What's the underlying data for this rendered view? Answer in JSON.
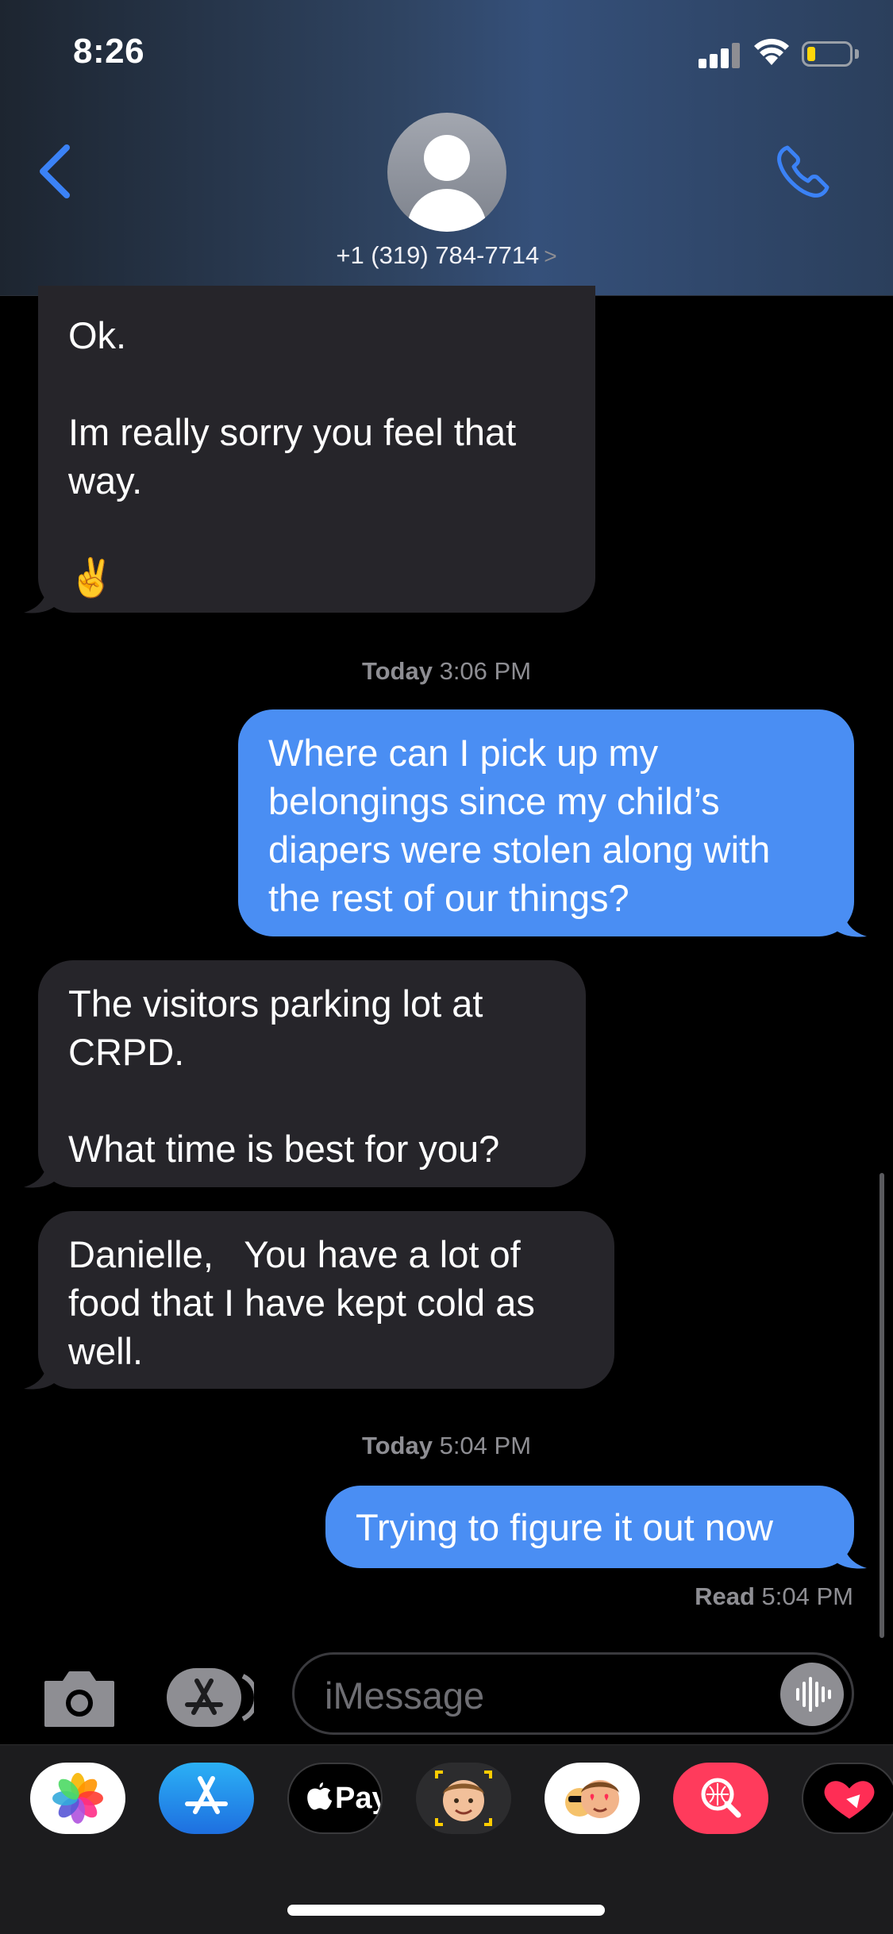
{
  "status_bar": {
    "time": "8:26"
  },
  "header": {
    "contact": "+1 (319) 784-7714",
    "chevron": ">"
  },
  "messages": [
    {
      "dir": "received",
      "text": "Ok.\n\nIm really sorry you feel that way.\n\n✌️"
    },
    {
      "dir": "timestamp",
      "day": "Today",
      "time": "3:06 PM"
    },
    {
      "dir": "sent",
      "text": "Where can I pick up my belongings since my child’s diapers were stolen along with the rest of our things?"
    },
    {
      "dir": "received",
      "text": "The visitors parking lot at CRPD.\n\nWhat time is best for you?"
    },
    {
      "dir": "received",
      "text": "Danielle,   You have a lot of food that I have kept cold as well."
    },
    {
      "dir": "timestamp",
      "day": "Today",
      "time": "5:04 PM"
    },
    {
      "dir": "sent",
      "text": "Trying to figure it out now"
    }
  ],
  "read_receipt": {
    "label": "Read",
    "time": "5:04 PM"
  },
  "composer": {
    "placeholder": "iMessage"
  },
  "app_drawer": {
    "items": [
      "photos-icon",
      "app-store-icon",
      "apple-pay-icon",
      "memoji-camera-icon",
      "memoji-stickers-icon",
      "search-images-icon",
      "digital-touch-icon"
    ],
    "apple_pay_label": "Pay"
  },
  "colors": {
    "sent": "#4a8ef3",
    "received": "#26252a",
    "accent": "#3b82f6"
  }
}
